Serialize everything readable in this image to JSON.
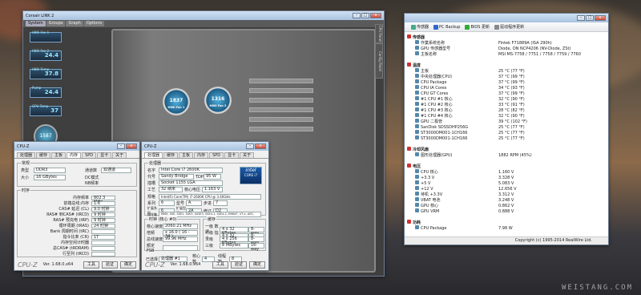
{
  "corsair": {
    "title": "Corsair LINK 2",
    "tabs": [
      "System",
      "Groups",
      "Graph",
      "Options"
    ],
    "active_tab": "System",
    "side_tabs": [
      "Config Panel",
      "CPU Panel"
    ],
    "gauges": [
      {
        "label": "H80i Fan 1",
        "value": ""
      },
      {
        "label": "H80i Fan 2",
        "value": "24.4"
      },
      {
        "label": "H80i Temp",
        "value": "37.8"
      },
      {
        "label": "Pump",
        "value": "24.4"
      },
      {
        "label": "GPU Temp",
        "value": "37"
      }
    ],
    "dials": [
      {
        "label": "",
        "value": "1587"
      }
    ],
    "fans": [
      {
        "value": "1837",
        "label": "H80i Fan 1"
      },
      {
        "value": "1316",
        "label": "H80i Fan 2"
      }
    ]
  },
  "cpuz_mem": {
    "title": "CPU-Z",
    "tabs": [
      "处理器",
      "缓存",
      "主板",
      "内存",
      "SPD",
      "显卡",
      "关于"
    ],
    "active_tab": "内存",
    "general_title": "常规",
    "type_label": "类型",
    "type_value": "DDR3",
    "size_label": "大小",
    "size_value": "16 GBytes",
    "channel_label": "通道数",
    "channel_value": "双通道",
    "dc_mode_label": "DC模式",
    "nb_freq_label": "NB频率",
    "timing_title": "时序",
    "timings": [
      {
        "label": "内存频率",
        "value": "802.3 MHz"
      },
      {
        "label": "前端总线:内存",
        "value": "1:6"
      },
      {
        "label": "CAS# 延迟 (CL)",
        "value": "9.0 时钟"
      },
      {
        "label": "RAS# 到CAS# (tRCD)",
        "value": "9 时钟"
      },
      {
        "label": "RAS# 预充电 (tRP)",
        "value": "9 时钟"
      },
      {
        "label": "循环周期 (tRAS)",
        "value": "24 时钟"
      },
      {
        "label": "Bank 周期时间 (tRC)",
        "value": ""
      },
      {
        "label": "指令比率 (CR)",
        "value": "1T"
      },
      {
        "label": "内存空闲计时器",
        "value": ""
      },
      {
        "label": "总CAS# (tRDRAM)",
        "value": ""
      },
      {
        "label": "行至列 (tRCD)",
        "value": ""
      }
    ],
    "version": "Ver. 1.68.0.x64",
    "tools_button": "工具",
    "validate_button": "验证",
    "ok_button": "确定"
  },
  "cpuz_cpu": {
    "title": "CPU-Z",
    "tabs": [
      "处理器",
      "缓存",
      "主板",
      "内存",
      "SPD",
      "显卡",
      "关于"
    ],
    "active_tab": "处理器",
    "processor_title": "处理器",
    "fields": [
      {
        "label": "名字",
        "value": "Intel Core i7 2600K"
      },
      {
        "label": "代号",
        "value": "Sandy Bridge"
      },
      {
        "label": "插槽",
        "value": "Socket 1155 LGA"
      },
      {
        "label": "工艺",
        "value": "32 纳米"
      },
      {
        "label": "规格",
        "value": "Intel(R) Core(TM) i7-2600K CPU @ 3.40GHz"
      },
      {
        "label": "指令集",
        "value": "MMX, SSE, SSE2, SSE3, SSSE3, SSE4.1, SSE4.2, EM64T, VT-x, AES, AVX"
      }
    ],
    "tdp_label": "TDP",
    "tdp_value": "95 W",
    "voltage_label": "核心电压",
    "voltage_value": "1.163 V",
    "family_label": "系列",
    "family_value": "6",
    "model_label": "型号",
    "model_value": "A",
    "stepping_label": "步进",
    "stepping_value": "7",
    "ext_family_label": "扩展系列",
    "ext_family_value": "6",
    "ext_model_label": "扩展型号",
    "ext_model_value": "2A",
    "revision_label": "修订",
    "revision_value": "D2",
    "clocks_title": "时钟 (核心 #0)",
    "core_speed_label": "核心速度",
    "core_speed_value": "2060.21 MHz",
    "multiplier_label": "倍频",
    "multiplier_value": "x 16.0 ( 16 - 34 )",
    "bus_label": "总线速度",
    "bus_value": "99.96 MHz",
    "fsb_label": "额定 FSB",
    "cache_title": "缓存",
    "caches": [
      {
        "label": "一级 数据",
        "value": "4 x 32 KBytes",
        "way": "8-way"
      },
      {
        "label": "一级 指令",
        "value": "4 x 32 KBytes",
        "way": "8-way"
      },
      {
        "label": "二级",
        "value": "4 x 256 KBytes",
        "way": "8-way"
      },
      {
        "label": "三级",
        "value": "8 MBytes",
        "way": "16-way"
      }
    ],
    "selection_label": "已选择",
    "selection_value": "处理器 #1",
    "cores_label": "核心数",
    "cores_value": "4",
    "threads_label": "线程数",
    "threads_value": "8",
    "badge_brand": "intel",
    "badge_line": "CORE i7",
    "version": "Ver. 1.68.0.x64",
    "tools_button": "工具",
    "validate_button": "验证",
    "ok_button": "确定"
  },
  "hwinfo": {
    "toolbar": [
      "传感器",
      "PC Backup",
      "BIOS 更新",
      "驱动程序更新"
    ],
    "rows": [
      {
        "n": "传感器",
        "v": "",
        "cls": "sec"
      },
      {
        "n": "作業系统名称",
        "v": "Fintek F71889A (ISA 290h)",
        "cls": "ind"
      },
      {
        "n": "GPU 传感器型号",
        "v": "Diode, ON NCP4206 (NV-Diode, ZSt)",
        "cls": "ind"
      },
      {
        "n": "主板名称",
        "v": "MSI MS-7758 / 7751 / 7758 / 7759 / 7760",
        "cls": "ind"
      },
      {
        "n": "",
        "v": "",
        "cls": ""
      },
      {
        "n": "温度",
        "v": "",
        "cls": "sec"
      },
      {
        "n": "主板",
        "v": "25 °C  (77 °F)",
        "cls": "ind"
      },
      {
        "n": "中央处理器(CPU)",
        "v": "37 °C  (99 °F)",
        "cls": "ind"
      },
      {
        "n": "CPU Package",
        "v": "37 °C  (99 °F)",
        "cls": "ind"
      },
      {
        "n": "CPU IA Cores",
        "v": "34 °C  (93 °F)",
        "cls": "ind"
      },
      {
        "n": "CPU GT Cores",
        "v": "37 °C  (99 °F)",
        "cls": "ind"
      },
      {
        "n": "#1 CPU #1 核心",
        "v": "32 °C  (90 °F)",
        "cls": "ind"
      },
      {
        "n": "#1 CPU #2 核心",
        "v": "33 °C  (91 °F)",
        "cls": "ind"
      },
      {
        "n": "#1 CPU #3 核心",
        "v": "28 °C  (82 °F)",
        "cls": "ind"
      },
      {
        "n": "#1 CPU #4 核心",
        "v": "32 °C  (90 °F)",
        "cls": "ind"
      },
      {
        "n": "GPU 二极管",
        "v": "39 °C  (102 °F)",
        "cls": "ind"
      },
      {
        "n": "SanDisk SDSSDHP256G",
        "v": "25 °C  (77 °F)",
        "cls": "ind"
      },
      {
        "n": "ST3000DM001-1CH166",
        "v": "25 °C  (77 °F)",
        "cls": "ind"
      },
      {
        "n": "ST3000DM001-1CH166",
        "v": "25 °C  (77 °F)",
        "cls": "ind"
      },
      {
        "n": "",
        "v": "",
        "cls": ""
      },
      {
        "n": "冷却风扇",
        "v": "",
        "cls": "sec"
      },
      {
        "n": "图形处理器(GPU)",
        "v": "1882 RPM  (45%)",
        "cls": "ind"
      },
      {
        "n": "",
        "v": "",
        "cls": ""
      },
      {
        "n": "电压",
        "v": "",
        "cls": "sec"
      },
      {
        "n": "CPU 核心",
        "v": "1.160 V",
        "cls": "ind"
      },
      {
        "n": "+3.3 V",
        "v": "3.328 V",
        "cls": "ind"
      },
      {
        "n": "+5 V",
        "v": "5.083 V",
        "cls": "ind"
      },
      {
        "n": "+12 V",
        "v": "12.656 V",
        "cls": "ind"
      },
      {
        "n": "待机 +3.3V",
        "v": "3.312 V",
        "cls": "ind"
      },
      {
        "n": "VBAT 电池",
        "v": "3.248 V",
        "cls": "ind"
      },
      {
        "n": "GPU 核心",
        "v": "0.862 V",
        "cls": "ind"
      },
      {
        "n": "GPU VRM",
        "v": "0.888 V",
        "cls": "ind"
      },
      {
        "n": "",
        "v": "",
        "cls": ""
      },
      {
        "n": "功耗",
        "v": "",
        "cls": "sec"
      },
      {
        "n": "CPU Package",
        "v": "7.98 W",
        "cls": "ind"
      }
    ],
    "status": "Copyright (c) 1995-2014 RealWire Ltd."
  },
  "watermark": "WEISTANG.COM"
}
